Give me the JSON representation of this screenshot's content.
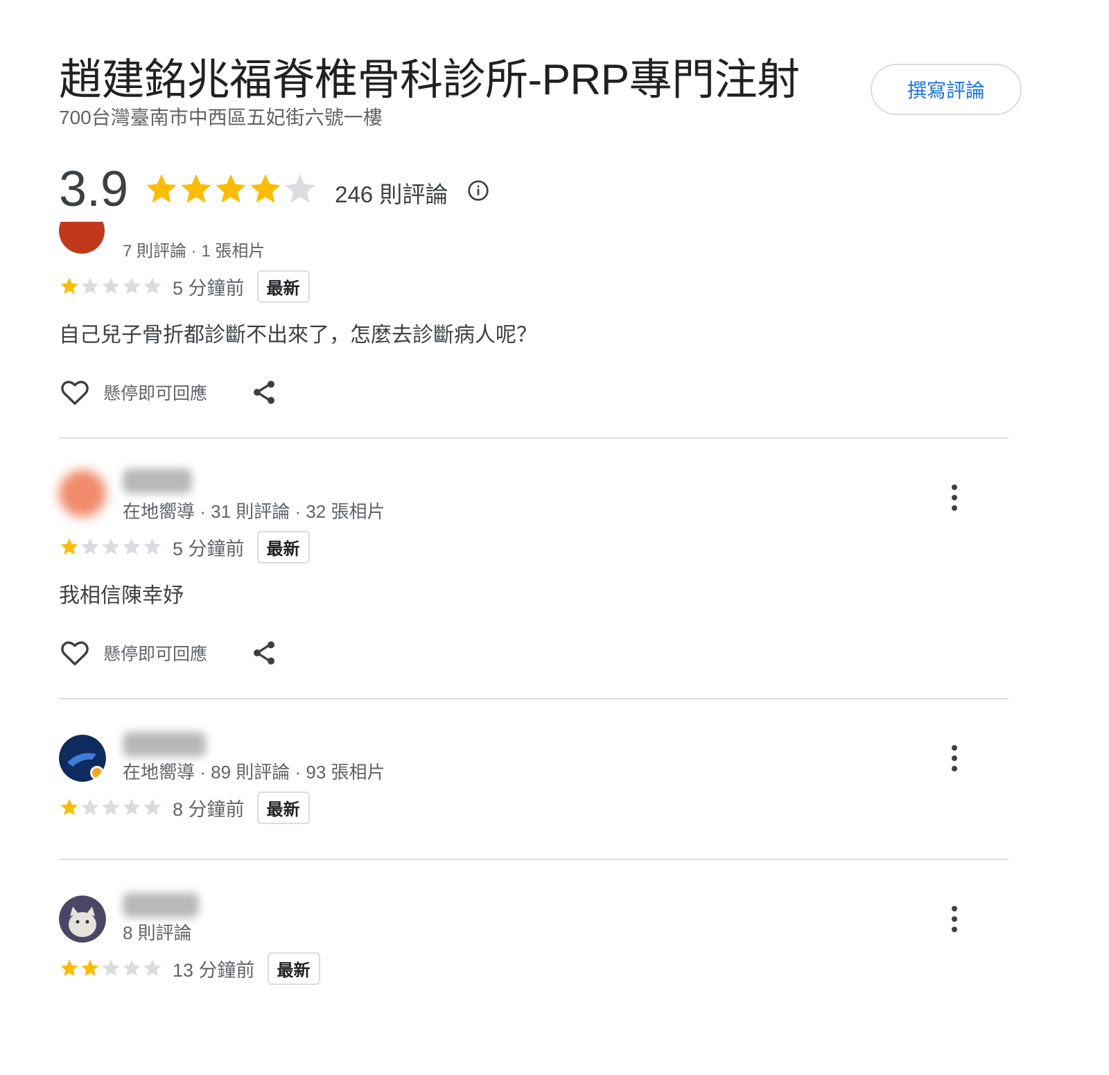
{
  "place": {
    "title": "趙建銘兆福脊椎骨科診所-PRP專門注射",
    "address": "700台灣臺南市中西區五妃街六號一樓",
    "write_review_label": "撰寫評論",
    "rating": "3.9",
    "rating_value": 3.9,
    "review_count_label": "246 則評論",
    "info_icon": "info-icon"
  },
  "colors": {
    "star_filled": "#fbbc04",
    "star_empty": "#dadce0",
    "accent": "#1a73e8"
  },
  "reviews": [
    {
      "meta": "7 則評論 · 1 張相片",
      "stars": 1,
      "time": "5 分鐘前",
      "badge": "最新",
      "text": "自己兒子骨折都診斷不出來了，怎麼去診斷病人呢？",
      "hover_label": "懸停即可回應"
    },
    {
      "meta": "在地嚮導 · 31 則評論 · 32 張相片",
      "stars": 1,
      "time": "5 分鐘前",
      "badge": "最新",
      "text": "我相信陳幸妤",
      "hover_label": "懸停即可回應"
    },
    {
      "meta": "在地嚮導 · 89 則評論 · 93 張相片",
      "stars": 1,
      "time": "8 分鐘前",
      "badge": "最新"
    },
    {
      "meta": "8 則評論",
      "stars": 2,
      "time": "13 分鐘前",
      "badge": "最新"
    }
  ]
}
